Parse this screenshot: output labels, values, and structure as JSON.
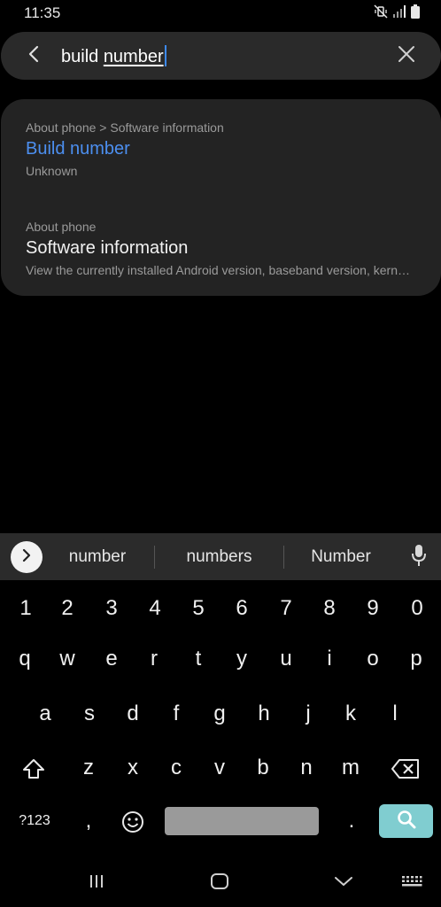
{
  "status_bar": {
    "time": "11:35",
    "icons": [
      "mute-vibrate-icon",
      "signal-icon",
      "battery-icon"
    ]
  },
  "search": {
    "query_plain": "build ",
    "query_underlined": "number",
    "back_icon": "chevron-left-icon",
    "clear_icon": "close-icon"
  },
  "results": [
    {
      "path": "About phone > Software information",
      "title": "Build number",
      "subtitle": "Unknown",
      "highlighted": true
    },
    {
      "path": "About phone",
      "title": "Software information",
      "subtitle": "View the currently installed Android version, baseband version, kernel version, build number, and more.",
      "highlighted": false
    }
  ],
  "keyboard": {
    "suggestions": [
      "number",
      "numbers",
      "Number"
    ],
    "number_row": [
      "1",
      "2",
      "3",
      "4",
      "5",
      "6",
      "7",
      "8",
      "9",
      "0"
    ],
    "row1": [
      "q",
      "w",
      "e",
      "r",
      "t",
      "y",
      "u",
      "i",
      "o",
      "p"
    ],
    "row2": [
      "a",
      "s",
      "d",
      "f",
      "g",
      "h",
      "j",
      "k",
      "l"
    ],
    "row3": [
      "z",
      "x",
      "c",
      "v",
      "b",
      "n",
      "m"
    ],
    "symbols_label": "?123",
    "comma_label": ",",
    "period_label": ".",
    "colors": {
      "search_key": "#80cdd0",
      "space_key": "#9a9a9a",
      "highlight_text": "#4c8ff0"
    }
  },
  "nav_bar": {
    "icons": [
      "recent-apps-icon",
      "home-icon",
      "back-icon",
      "keyboard-icon"
    ]
  }
}
